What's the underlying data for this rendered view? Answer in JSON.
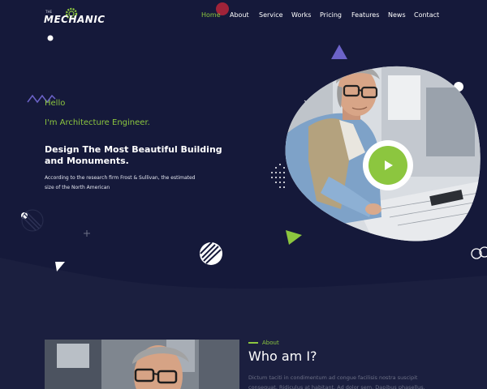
{
  "brand": {
    "small": "THE",
    "name": "MECHANIC"
  },
  "nav": {
    "items": [
      "Home",
      "About",
      "Service",
      "Works",
      "Pricing",
      "Features",
      "News",
      "Contact"
    ],
    "active": "Home"
  },
  "hero": {
    "greeting": "Hello",
    "role": "I'm Architecture Engineer.",
    "headline": "Design The Most Beautiful Building and Monuments.",
    "description": "According to the research firm Frost & Sullivan, the estimated size of the North American"
  },
  "about": {
    "tag": "About",
    "title": "Who am I?",
    "text": "Dictum taciti in condimentum ad congue facilisis nostra suscipit consequat. Ridiculus at habitant. Ad dolor sem. Dapibus phasellus. Consequat congue"
  },
  "colors": {
    "background": "#15193a",
    "accent": "#8cc63f",
    "shape_purple": "#6c63c9"
  },
  "icons": [
    "gear-icon",
    "play-icon"
  ]
}
